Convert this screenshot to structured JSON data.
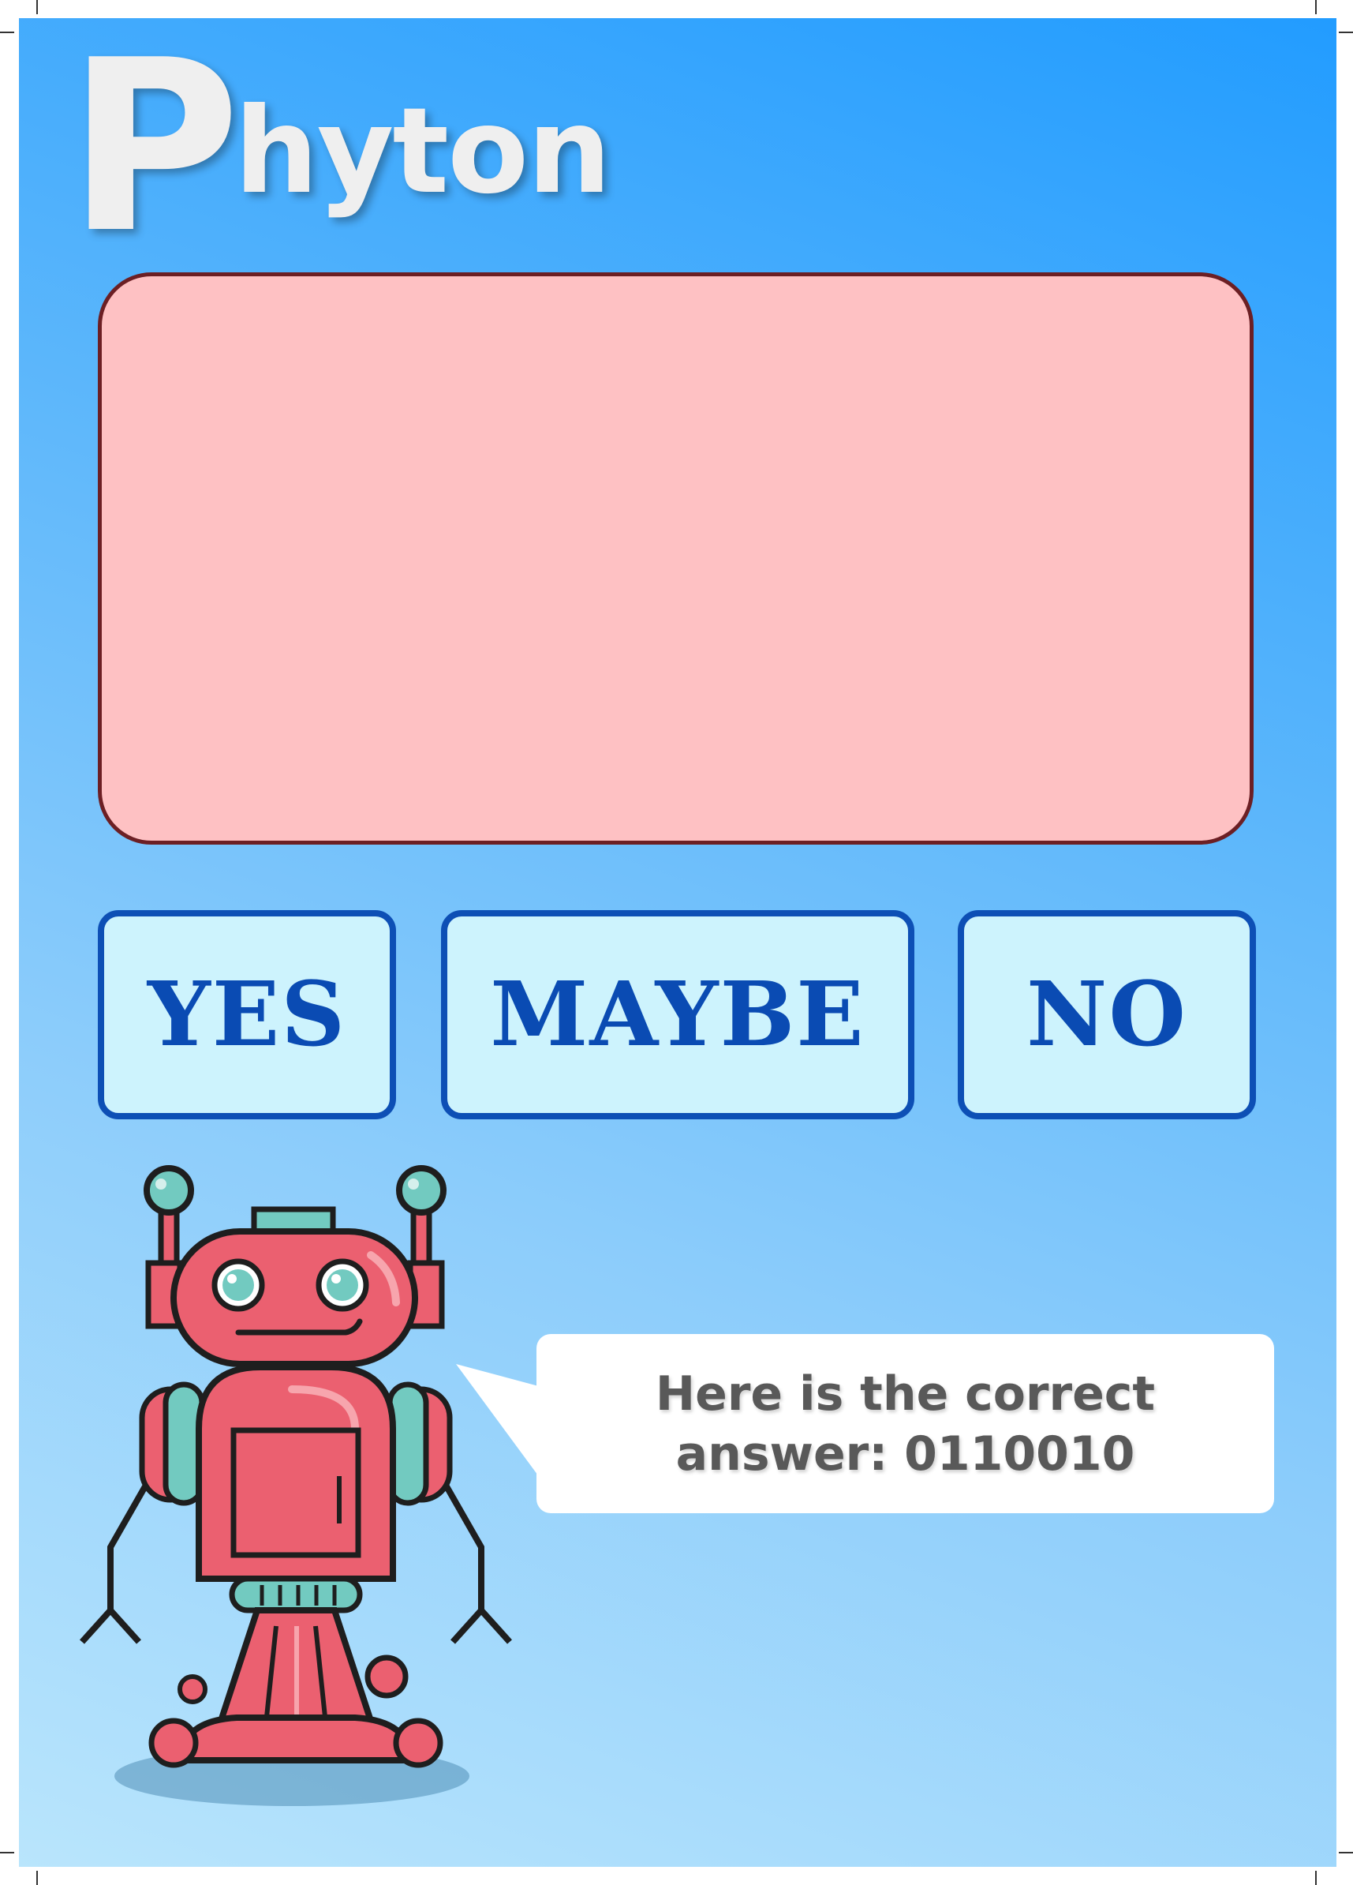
{
  "title": {
    "first_letter": "P",
    "rest": "hyton"
  },
  "question_box": {
    "text": ""
  },
  "answers": {
    "yes": "YES",
    "maybe": "MAYBE",
    "no": "NO"
  },
  "speech_bubble": {
    "line1": "Here is the correct",
    "line2": "answer: 0110010"
  },
  "icons": {
    "mascot": "robot-icon"
  },
  "colors": {
    "background_top": "#229cff",
    "background_bottom": "#b9e5fc",
    "title": "#efefef",
    "question_fill": "#fec1c3",
    "question_border": "#6c1f24",
    "button_fill": "#cdf3fd",
    "button_border": "#0d4fb5",
    "button_text": "#0a4bb3",
    "robot_body": "#eb6070",
    "robot_accent": "#72cac0",
    "bubble_text": "#595959"
  }
}
